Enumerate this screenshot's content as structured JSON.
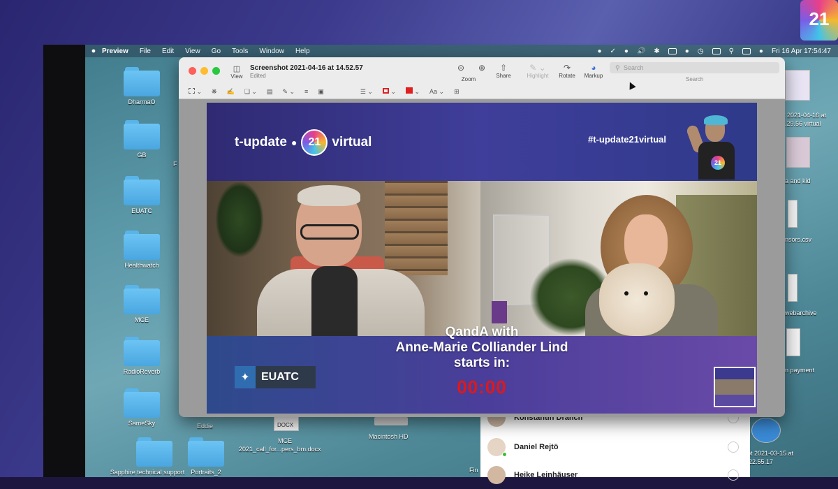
{
  "menubar": {
    "apple": "",
    "items": [
      "Preview",
      "File",
      "Edit",
      "View",
      "Go",
      "Tools",
      "Window",
      "Help"
    ],
    "clock": "Fri 16 Apr  17:54:47"
  },
  "desktop": {
    "folders": [
      {
        "label": "DharmaO"
      },
      {
        "label": "GB"
      },
      {
        "label": "EUATC"
      },
      {
        "label": "Healthwatch"
      },
      {
        "label": "MCE"
      },
      {
        "label": "RadioReverb"
      },
      {
        "label": "SameSky"
      },
      {
        "label": "Sapphire technical support"
      }
    ],
    "folder_eddie": "Eddie",
    "folder_portraits": "Portraits_2",
    "doc_badge": "DOCX",
    "doc_label_1": "MCE",
    "doc_label_2": "2021_call_for...pers_bm.docx",
    "hd_label": "Macintosh HD",
    "f_label": "F",
    "fin_label": "Fin",
    "right_files": [
      "t 2021-04-16 at",
      ".29.56 virtual",
      "a and kid",
      "nsors.csv",
      "webarchive",
      "n payment",
      "ot 2021-03-15 at",
      "22.55.17"
    ]
  },
  "preview": {
    "title": "Screenshot 2021-04-16 at 14.52.57",
    "subtitle": "Edited",
    "view_label": "View",
    "toolbar": {
      "zoom": "Zoom",
      "share": "Share",
      "highlight": "Highlight",
      "rotate": "Rotate",
      "markup": "Markup"
    },
    "search_placeholder": "Search",
    "search_caption": "Search",
    "slide": {
      "brand_left": "t-update",
      "brand_right": "virtual",
      "badge": "21",
      "hashtag": "#t-update21virtual",
      "qanda_line1": "QandA with",
      "qanda_line2": "Anne-Marie Colliander Lind",
      "qanda_line3": "starts in:",
      "countdown": "00:00",
      "euatc": "EUATC"
    }
  },
  "chat": {
    "participants": [
      {
        "name": "Konstantin Dranch"
      },
      {
        "name": "Daniel Rejtö"
      },
      {
        "name": "Heike Leinhäuser"
      }
    ]
  },
  "corner_logo": "21",
  "colors": {
    "countdown": "#e01818",
    "folder": "#5cb6ee",
    "accent_blue": "#2f6db0"
  }
}
